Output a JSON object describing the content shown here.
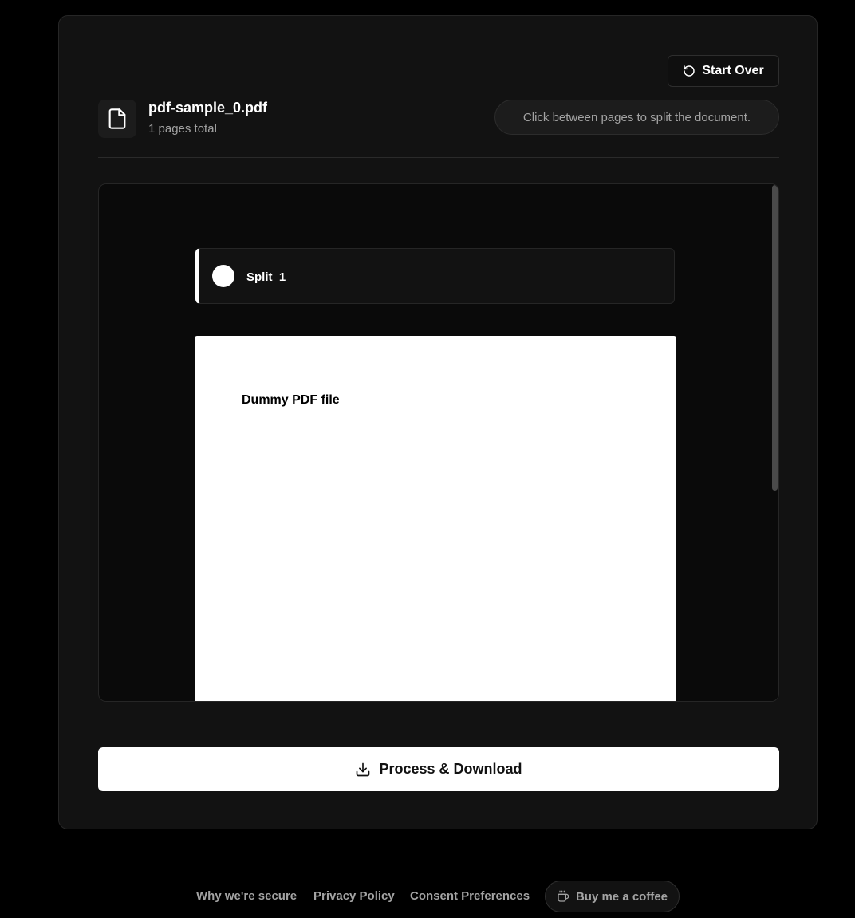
{
  "header": {
    "start_over_label": "Start Over",
    "file_name": "pdf-sample_0.pdf",
    "pages_total": "1 pages total",
    "hint": "Click between pages to split the document."
  },
  "viewer": {
    "splits": [
      {
        "name": "Split_1"
      }
    ],
    "page_text": "Dummy PDF file",
    "scroll_position_fraction": 0
  },
  "actions": {
    "process_label": "Process & Download"
  },
  "footer": {
    "links": [
      {
        "label": "Why we're secure"
      },
      {
        "label": "Privacy Policy"
      },
      {
        "label": "Consent Preferences"
      }
    ],
    "coffee_label": "Buy me a coffee"
  },
  "icons": {
    "start_over": "rotate-ccw-icon",
    "file": "file-icon",
    "download": "download-icon",
    "coffee": "coffee-icon"
  },
  "colors": {
    "background": "#000000",
    "card": "#121212",
    "accent": "#ffffff",
    "muted_text": "#a3a3a3"
  }
}
